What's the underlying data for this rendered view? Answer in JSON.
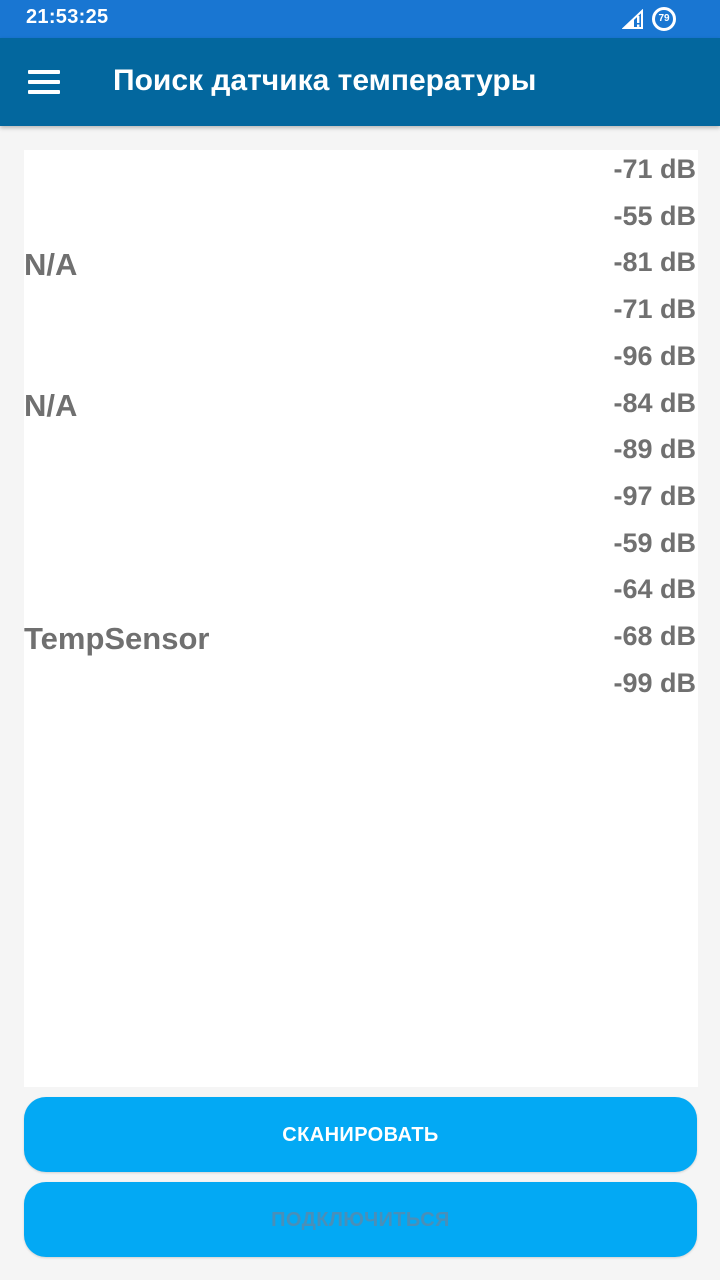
{
  "status_bar": {
    "time": "21:53:25",
    "battery_level": "79",
    "icons": [
      "signal-icon",
      "battery-icon"
    ]
  },
  "app_bar": {
    "menu_icon": "menu-icon",
    "title": "Поиск датчика температуры"
  },
  "devices": [
    {
      "name": "",
      "rssi": "-71 dB"
    },
    {
      "name": "",
      "rssi": "-55 dB"
    },
    {
      "name": "N/A",
      "rssi": "-81 dB"
    },
    {
      "name": "",
      "rssi": "-71 dB"
    },
    {
      "name": "",
      "rssi": "-96 dB"
    },
    {
      "name": "N/A",
      "rssi": "-84 dB"
    },
    {
      "name": "",
      "rssi": "-89 dB"
    },
    {
      "name": "",
      "rssi": "-97 dB"
    },
    {
      "name": "",
      "rssi": "-59 dB"
    },
    {
      "name": "",
      "rssi": "-64 dB"
    },
    {
      "name": "TempSensor",
      "rssi": "-68 dB"
    },
    {
      "name": "",
      "rssi": "-99 dB"
    }
  ],
  "buttons": {
    "scan_label": "СКАНИРОВАТЬ",
    "connect_label": "ПОДКЛЮЧИТЬСЯ",
    "connect_enabled": false
  },
  "colors": {
    "status_bar": "#1976d2",
    "app_bar": "#03679e",
    "button": "#03a9f4",
    "text_secondary": "#707070"
  }
}
